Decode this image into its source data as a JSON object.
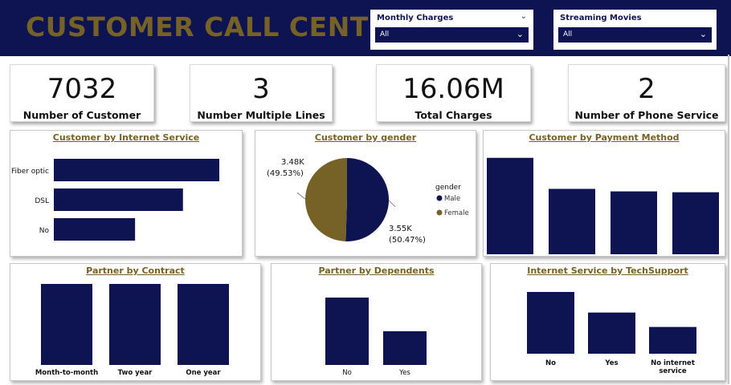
{
  "header": {
    "title": "CUSTOMER CALL CENTRE"
  },
  "slicers": [
    {
      "label": "Monthly Charges",
      "value": "All"
    },
    {
      "label": "Streaming Movies",
      "value": "All"
    }
  ],
  "kpis": [
    {
      "value": "7032",
      "label": "Number of Customer"
    },
    {
      "value": "3",
      "label": "Number Multiple Lines"
    },
    {
      "value": "16.06M",
      "label": "Total Charges"
    },
    {
      "value": "2",
      "label": "Number of Phone Service"
    }
  ],
  "colors": {
    "navy": "#0d1451",
    "gold": "#766226"
  },
  "chart_data": [
    {
      "id": "internet",
      "type": "bar",
      "orientation": "horizontal",
      "title": "Customer by Internet Service",
      "categories": [
        "Fiber optic",
        "DSL",
        "No"
      ],
      "values": [
        3096,
        2416,
        1520
      ]
    },
    {
      "id": "gender",
      "type": "pie",
      "title": "Customer by gender",
      "legend_title": "gender",
      "slices": [
        {
          "name": "Male",
          "value": 3.55,
          "label": "3.55K",
          "pct": "(50.47%)",
          "color": "#0d1451"
        },
        {
          "name": "Female",
          "value": 3.48,
          "label": "3.48K",
          "pct": "(49.53%)",
          "color": "#766226"
        }
      ]
    },
    {
      "id": "payment",
      "type": "bar",
      "title": "Customer by Payment Method",
      "categories": [
        "",
        "",
        "",
        ""
      ],
      "values": [
        2365,
        1604,
        1542,
        1521
      ],
      "ylim": [
        0,
        2400
      ]
    },
    {
      "id": "contract",
      "type": "bar",
      "title": "Partner by Contract",
      "categories": [
        "Month-to-month",
        "Two year",
        "One year"
      ],
      "values": [
        1,
        1,
        1
      ]
    },
    {
      "id": "dependents",
      "type": "bar",
      "title": "Partner by Dependents",
      "categories": [
        "No",
        "Yes"
      ],
      "values": [
        2,
        1
      ]
    },
    {
      "id": "techsupport",
      "type": "bar",
      "title": "Internet Service by TechSupport",
      "categories": [
        "No",
        "Yes",
        "No internet service"
      ],
      "values": [
        3,
        2,
        1.3
      ]
    }
  ]
}
